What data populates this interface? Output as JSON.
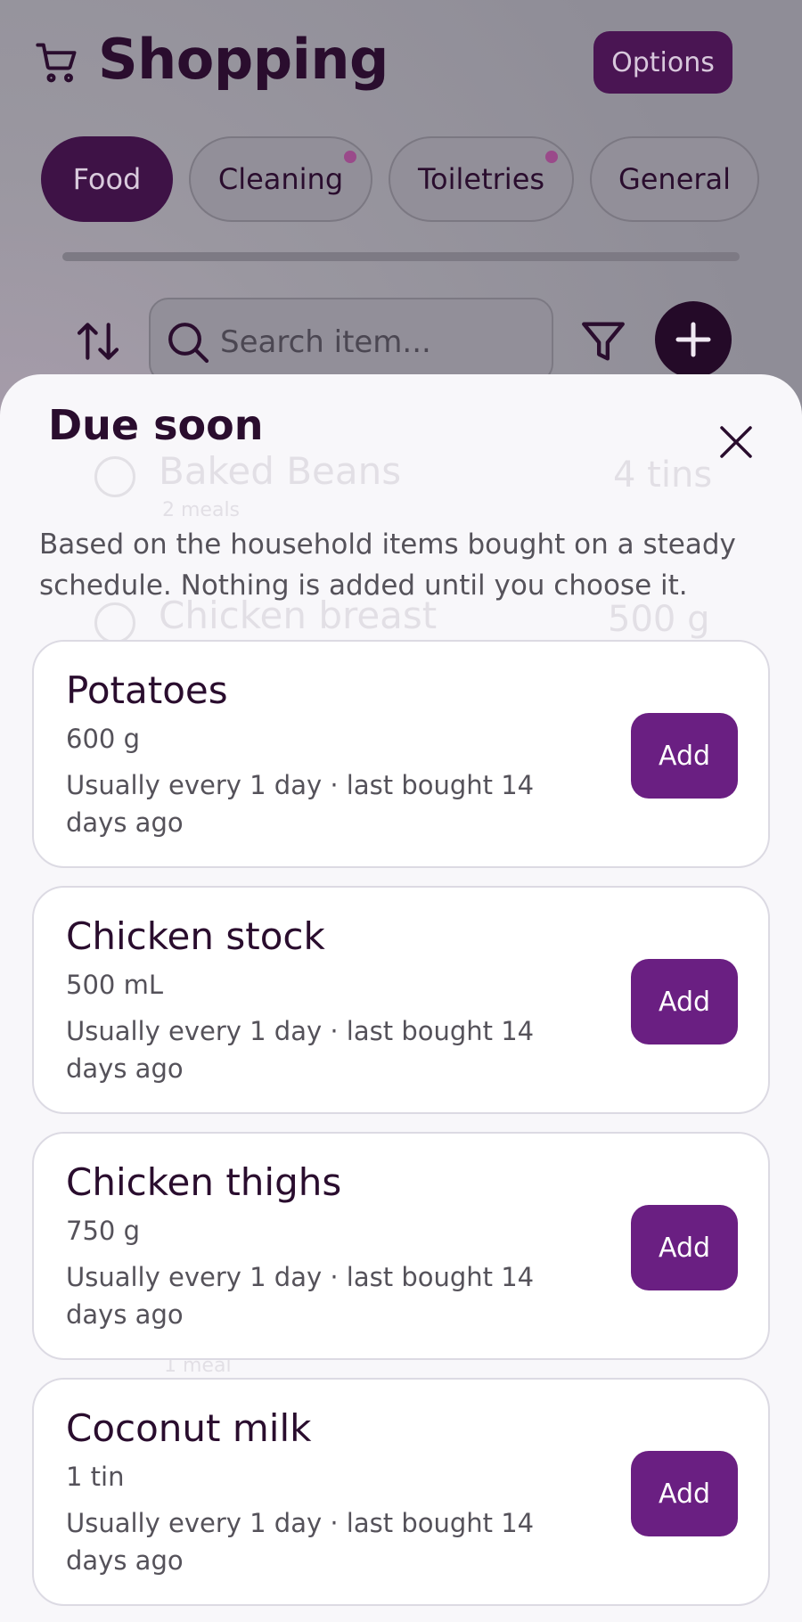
{
  "header": {
    "title": "Shopping",
    "options_label": "Options"
  },
  "tabs": [
    {
      "label": "Food",
      "active": true,
      "has_dot": false
    },
    {
      "label": "Cleaning",
      "active": false,
      "has_dot": true
    },
    {
      "label": "Toiletries",
      "active": false,
      "has_dot": true
    },
    {
      "label": "General",
      "active": false,
      "has_dot": false
    }
  ],
  "search": {
    "placeholder": "Search item..."
  },
  "background_list": [
    {
      "name": "Baked Beans",
      "sub": "2 meals",
      "qty": "4 tins"
    },
    {
      "name": "Chicken breast",
      "qty": "500 g"
    },
    {
      "sub": "1 meal"
    }
  ],
  "sheet": {
    "title": "Due soon",
    "description": "Based on the household items bought on a steady schedule. Nothing is added until you choose it.",
    "add_label": "Add",
    "items": [
      {
        "name": "Potatoes",
        "qty": "600 g",
        "schedule": "Usually every 1 day · last bought 14 days ago"
      },
      {
        "name": "Chicken stock",
        "qty": "500 mL",
        "schedule": "Usually every 1 day · last bought 14 days ago"
      },
      {
        "name": "Chicken thighs",
        "qty": "750 g",
        "schedule": "Usually every 1 day · last bought 14 days ago"
      },
      {
        "name": "Coconut milk",
        "qty": "1 tin",
        "schedule": "Usually every 1 day · last bought 14 days ago"
      }
    ]
  },
  "colors": {
    "brand_dark": "#2a0d2e",
    "tab_active": "#3e1246",
    "add_button": "#6a1f82",
    "dot": "#9a4a8a"
  }
}
